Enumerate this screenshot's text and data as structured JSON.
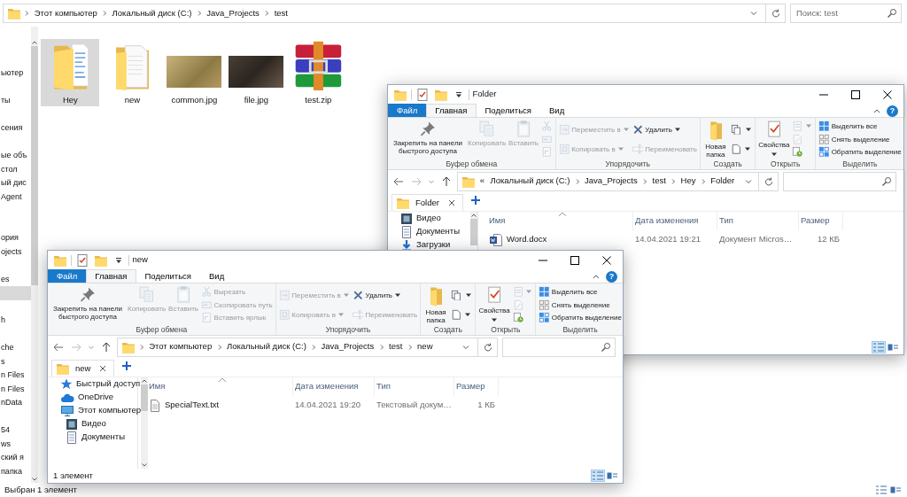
{
  "main_window": {
    "address": {
      "path": [
        "Этот компьютер",
        "Локальный диск (C:)",
        "Java_Projects",
        "test"
      ]
    },
    "search": {
      "placeholder": "Поиск: test"
    },
    "nav_items": [
      {
        "label": "ьютер",
        "selected": false
      },
      {
        "selected": false
      },
      {
        "label": "ты",
        "selected": false
      },
      {
        "selected": false
      },
      {
        "label": "сения",
        "selected": false
      },
      {
        "selected": false
      },
      {
        "label": "ые объ",
        "selected": false
      },
      {
        "label": "стол",
        "selected": false
      },
      {
        "label": "ый дис",
        "selected": false
      },
      {
        "label": "Agent",
        "selected": false
      },
      {
        "selected": false
      },
      {
        "selected": false
      },
      {
        "label": "ория",
        "selected": false
      },
      {
        "label": "ojects",
        "selected": false
      },
      {
        "selected": false
      },
      {
        "label": "es",
        "selected": false
      },
      {
        "selected": true
      },
      {
        "selected": false
      },
      {
        "label": "h",
        "selected": false
      },
      {
        "selected": false
      },
      {
        "label": "che",
        "selected": false
      },
      {
        "label": "s",
        "selected": false
      },
      {
        "label": "n Files",
        "selected": false
      },
      {
        "label": "n Files",
        "selected": false
      },
      {
        "label": "nData",
        "selected": false
      },
      {
        "selected": false
      },
      {
        "label": "54",
        "selected": false
      },
      {
        "label": "ws",
        "selected": false
      },
      {
        "label": "ский я",
        "selected": false
      },
      {
        "label": "папка",
        "selected": false
      }
    ],
    "files": [
      {
        "name": "Hey",
        "kind": "folder-docs",
        "selected": true
      },
      {
        "name": "new",
        "kind": "folder-page",
        "selected": false
      },
      {
        "name": "common.jpg",
        "kind": "photo-bird",
        "selected": false
      },
      {
        "name": "file.jpg",
        "kind": "photo-dark",
        "selected": false
      },
      {
        "name": "test.zip",
        "kind": "archive",
        "selected": false
      }
    ],
    "status": "Выбран 1 элемент"
  },
  "windows": [
    {
      "title": "Folder",
      "ribbon_tabs": [
        {
          "label": "Файл",
          "kind": "file",
          "selected": false
        },
        {
          "label": "Главная",
          "kind": "tab",
          "selected": true
        },
        {
          "label": "Поделиться",
          "kind": "tab",
          "selected": false
        },
        {
          "label": "Вид",
          "kind": "tab",
          "selected": false
        }
      ],
      "help": "?",
      "ribbon_groups": [
        {
          "label": "Буфер обмена",
          "columns": [
            [
              {
                "kind": "pin",
                "large": true,
                "label": "Закрепить на панели быстрого доступа",
                "disabled": false
              }
            ],
            [
              {
                "kind": "copy",
                "large": true,
                "label": "Копировать",
                "disabled": true
              }
            ],
            [
              {
                "kind": "paste",
                "large": true,
                "label": "Вставить",
                "disabled": true
              }
            ],
            [
              {
                "kind": "cut",
                "large": false,
                "disabled": true
              },
              {
                "kind": "copypath",
                "large": false,
                "disabled": true
              },
              {
                "kind": "shortcut",
                "large": false,
                "disabled": true
              }
            ]
          ]
        },
        {
          "label": "Упорядочить",
          "columns": [
            [
              {
                "kind": "move",
                "large": false,
                "label": "Переместить в",
                "disabled": true,
                "dropdown": true
              },
              {
                "kind": "copyto",
                "large": false,
                "label": "Копировать в",
                "disabled": true,
                "dropdown": true
              }
            ],
            [
              {
                "kind": "delete",
                "large": false,
                "label": "Удалить",
                "disabled": false,
                "dropdown": true
              },
              {
                "kind": "rename",
                "large": false,
                "label": "Переименовать",
                "disabled": true
              }
            ]
          ]
        },
        {
          "label": "Создать",
          "columns": [
            [
              {
                "kind": "newfolder",
                "large": true,
                "label": "Новая папка",
                "disabled": false
              }
            ],
            [
              {
                "kind": "newitem",
                "large": false,
                "disabled": false,
                "dropdown": true
              },
              {
                "kind": "easyaccess",
                "large": false,
                "disabled": false,
                "dropdown": true
              }
            ]
          ]
        },
        {
          "label": "Открыть",
          "columns": [
            [
              {
                "kind": "properties",
                "large": true,
                "label": "Свойства",
                "disabled": false,
                "dropdown": true
              }
            ],
            [
              {
                "kind": "open",
                "large": false,
                "disabled": true,
                "dropdown": true
              },
              {
                "kind": "edit",
                "large": false,
                "disabled": true
              },
              {
                "kind": "history",
                "large": false,
                "disabled": false
              }
            ]
          ]
        },
        {
          "label": "Выделить",
          "columns": [
            [
              {
                "kind": "selectall",
                "large": false,
                "label": "Выделить все",
                "disabled": false
              },
              {
                "kind": "selectnone",
                "large": false,
                "label": "Снять выделение",
                "disabled": false
              },
              {
                "kind": "invert",
                "large": false,
                "label": "Обратить выделение",
                "disabled": false
              }
            ]
          ]
        }
      ],
      "address": {
        "overflow": "«",
        "path": [
          "Локальный диск (C:)",
          "Java_Projects",
          "test",
          "Hey",
          "Folder"
        ]
      },
      "tab": {
        "label": "Folder"
      },
      "nav_items": [
        {
          "label": "Видео",
          "kind": "video"
        },
        {
          "label": "Документы",
          "kind": "documents"
        },
        {
          "label": "Загрузки",
          "kind": "downloads"
        }
      ],
      "columns": [
        "Имя",
        "Дата изменения",
        "Тип",
        "Размер"
      ],
      "rows": [
        {
          "name": "Word.docx",
          "kind": "word",
          "date": "14.04.2021 19:21",
          "type": "Документ Micros…",
          "size": "12 КБ"
        }
      ]
    },
    {
      "title": "new",
      "ribbon_tabs": [
        {
          "label": "Файл",
          "kind": "file",
          "selected": false
        },
        {
          "label": "Главная",
          "kind": "tab",
          "selected": true
        },
        {
          "label": "Поделиться",
          "kind": "tab",
          "selected": false
        },
        {
          "label": "Вид",
          "kind": "tab",
          "selected": false
        }
      ],
      "help": "?",
      "ribbon_groups": [
        {
          "label": "Буфер обмена",
          "columns": [
            [
              {
                "kind": "pin",
                "large": true,
                "label": "Закрепить на панели быстрого доступа",
                "disabled": false
              }
            ],
            [
              {
                "kind": "copy",
                "large": true,
                "label": "Копировать",
                "disabled": true
              }
            ],
            [
              {
                "kind": "paste",
                "large": true,
                "label": "Вставить",
                "disabled": true
              }
            ],
            [
              {
                "kind": "cut",
                "large": false,
                "label": "Вырезать",
                "disabled": true
              },
              {
                "kind": "copypath",
                "large": false,
                "label": "Скопировать путь",
                "disabled": true
              },
              {
                "kind": "shortcut",
                "large": false,
                "label": "Вставить ярлык",
                "disabled": true
              }
            ]
          ]
        },
        {
          "label": "Упорядочить",
          "columns": [
            [
              {
                "kind": "move",
                "large": false,
                "label": "Переместить в",
                "disabled": true,
                "dropdown": true
              },
              {
                "kind": "copyto",
                "large": false,
                "label": "Копировать в",
                "disabled": true,
                "dropdown": true
              }
            ],
            [
              {
                "kind": "delete",
                "large": false,
                "label": "Удалить",
                "disabled": false,
                "dropdown": true
              },
              {
                "kind": "rename",
                "large": false,
                "label": "Переименовать",
                "disabled": true
              }
            ]
          ]
        },
        {
          "label": "Создать",
          "columns": [
            [
              {
                "kind": "newfolder",
                "large": true,
                "label": "Новая папка",
                "disabled": false
              }
            ],
            [
              {
                "kind": "newitem",
                "large": false,
                "disabled": false,
                "dropdown": true
              },
              {
                "kind": "easyaccess",
                "large": false,
                "disabled": false,
                "dropdown": true
              }
            ]
          ]
        },
        {
          "label": "Открыть",
          "columns": [
            [
              {
                "kind": "properties",
                "large": true,
                "label": "Свойства",
                "disabled": false,
                "dropdown": true
              }
            ],
            [
              {
                "kind": "open",
                "large": false,
                "disabled": true,
                "dropdown": true
              },
              {
                "kind": "edit",
                "large": false,
                "disabled": true
              },
              {
                "kind": "history",
                "large": false,
                "disabled": false
              }
            ]
          ]
        },
        {
          "label": "Выделить",
          "columns": [
            [
              {
                "kind": "selectall",
                "large": false,
                "label": "Выделить все",
                "disabled": false
              },
              {
                "kind": "selectnone",
                "large": false,
                "label": "Снять выделение",
                "disabled": false
              },
              {
                "kind": "invert",
                "large": false,
                "label": "Обратить выделение",
                "disabled": false
              }
            ]
          ]
        }
      ],
      "address": {
        "path": [
          "Этот компьютер",
          "Локальный диск (C:)",
          "Java_Projects",
          "test",
          "new"
        ]
      },
      "tab": {
        "label": "new"
      },
      "nav_items": [
        {
          "label": "Быстрый доступ",
          "kind": "star"
        },
        {
          "label": "OneDrive",
          "kind": "cloud"
        },
        {
          "label": "Этот компьютер",
          "kind": "computer",
          "children": [
            {
              "label": "Видео",
              "kind": "video"
            },
            {
              "label": "Документы",
              "kind": "documents"
            }
          ]
        }
      ],
      "columns": [
        "Имя",
        "Дата изменения",
        "Тип",
        "Размер"
      ],
      "rows": [
        {
          "name": "SpecialText.txt",
          "kind": "txt",
          "date": "14.04.2021 19:20",
          "type": "Текстовый докум…",
          "size": "1 КБ"
        }
      ],
      "status": "1 элемент"
    }
  ]
}
